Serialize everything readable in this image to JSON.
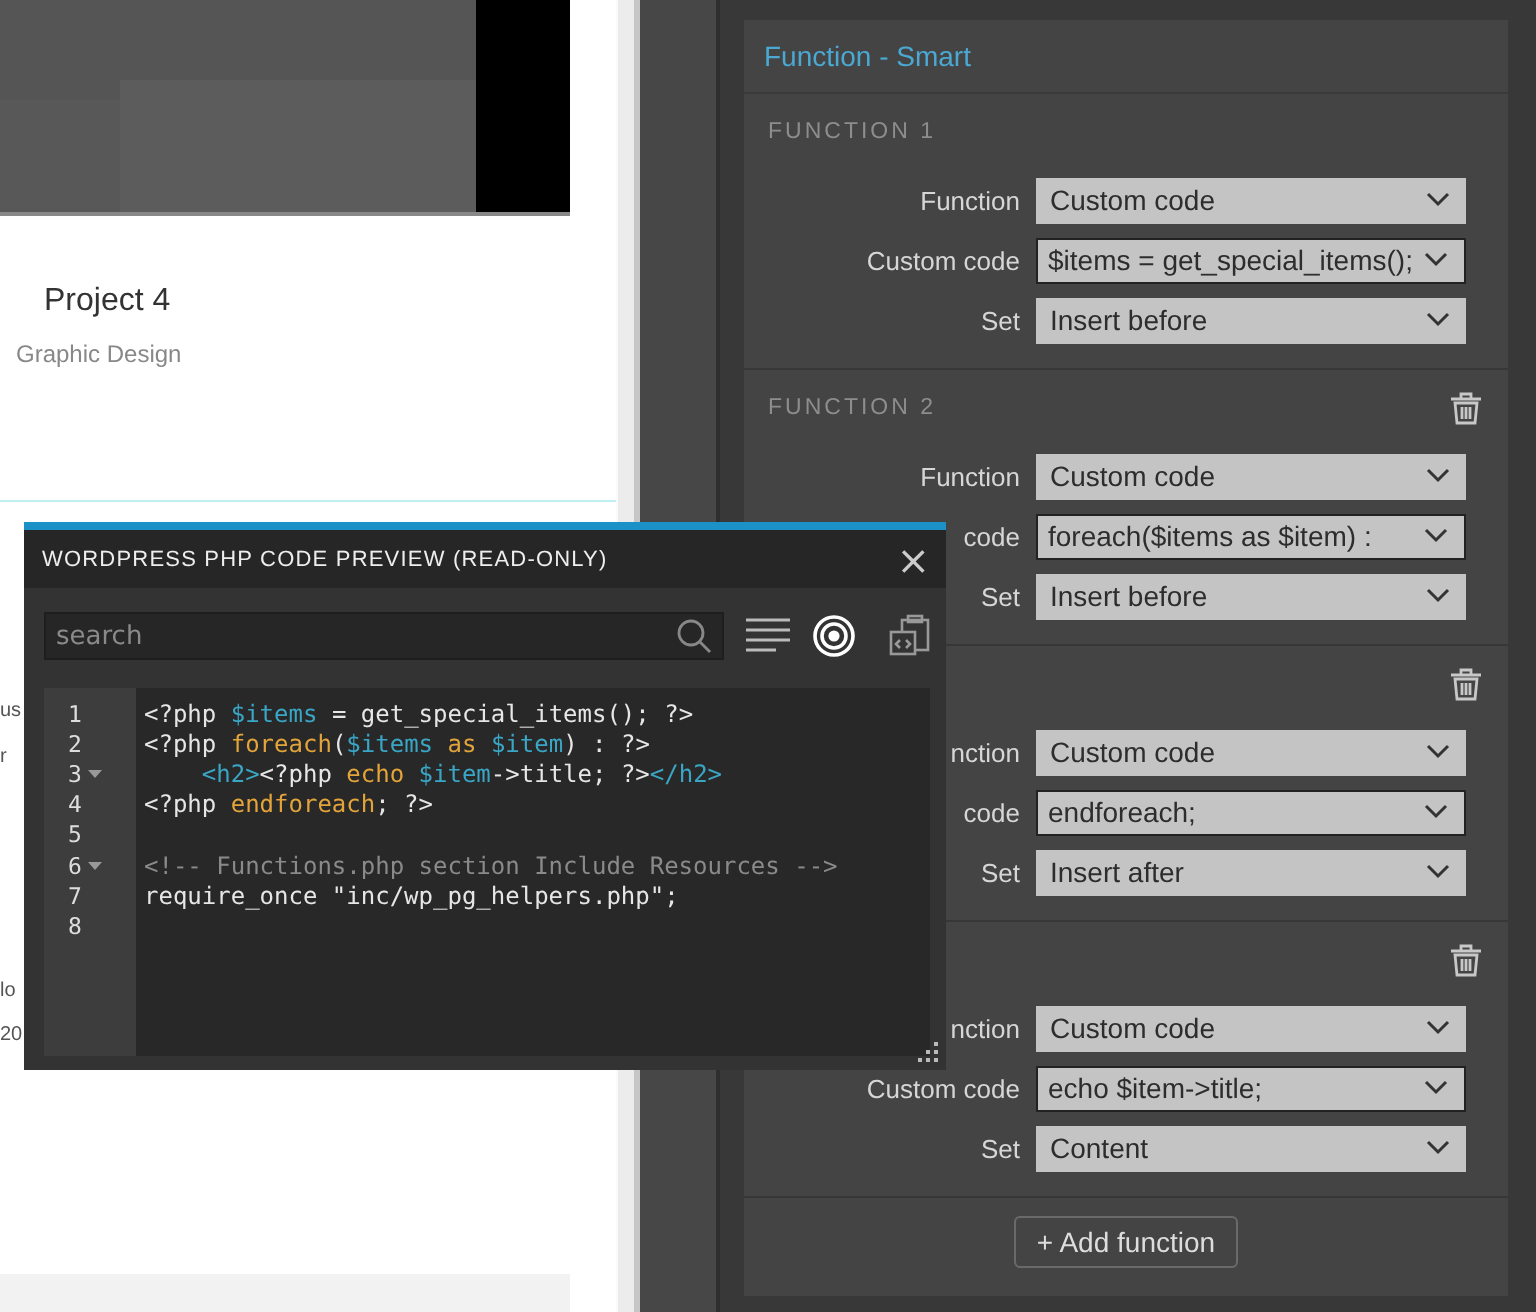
{
  "page_preview": {
    "card": {
      "kind": "picture",
      "title": "Project 4",
      "subtitle": "Graphic Design"
    },
    "hidden_fragments": [
      {
        "text": "us"
      },
      {
        "text": "r"
      },
      {
        "text": "lo"
      },
      {
        "text": "20"
      }
    ]
  },
  "panel": {
    "title": "Function - Smart",
    "functions": [
      {
        "heading": "FUNCTION 1",
        "deletable": false,
        "rows": [
          {
            "label": "Function",
            "value": "Custom code",
            "kind": "select"
          },
          {
            "label": "Custom code",
            "value": "$items = get_special_items();",
            "kind": "input"
          },
          {
            "label": "Set",
            "value": "Insert before",
            "kind": "select"
          }
        ]
      },
      {
        "heading": "FUNCTION 2",
        "deletable": true,
        "rows": [
          {
            "label": "Function",
            "value": "Custom code",
            "kind": "select"
          },
          {
            "label": "code",
            "value": "foreach($items as $item) :",
            "kind": "input"
          },
          {
            "label": "Set",
            "value": "Insert before",
            "kind": "select"
          }
        ]
      },
      {
        "deletable": true,
        "rows": [
          {
            "label": "nction",
            "value": "Custom code",
            "kind": "select"
          },
          {
            "label": "code",
            "value": "endforeach;",
            "kind": "input"
          },
          {
            "label": "Set",
            "value": "Insert after",
            "kind": "select"
          }
        ]
      },
      {
        "deletable": true,
        "rows": [
          {
            "label": "nction",
            "value": "Custom code",
            "kind": "select"
          },
          {
            "label": "Custom code",
            "value": "echo $item->title;",
            "kind": "input"
          },
          {
            "label": "Set",
            "value": "Content",
            "kind": "select"
          }
        ]
      }
    ],
    "add_button": "+ Add function"
  },
  "dialog": {
    "title": "WORDPRESS PHP CODE PREVIEW (READ-ONLY)",
    "close": "×",
    "search": {
      "placeholder": "search"
    },
    "lines": [
      {
        "number": "1",
        "fold": false,
        "tokens": [
          {
            "t": "<?php ",
            "kind": "plain"
          },
          {
            "t": "$items",
            "kind": "var"
          },
          {
            "t": " = get_special_items(); ?>",
            "kind": "plain"
          }
        ]
      },
      {
        "number": "2",
        "fold": false,
        "tokens": [
          {
            "t": "<?php ",
            "kind": "plain"
          },
          {
            "t": "foreach",
            "kind": "kw"
          },
          {
            "t": "(",
            "kind": "plain"
          },
          {
            "t": "$items",
            "kind": "var"
          },
          {
            "t": " as",
            "kind": "kw"
          },
          {
            "t": " $item",
            "kind": "var"
          },
          {
            "t": ") : ?>",
            "kind": "plain"
          }
        ]
      },
      {
        "number": "3",
        "fold": true,
        "tokens": [
          {
            "t": "    <h2>",
            "kind": "tag"
          },
          {
            "t": "<?php ",
            "kind": "plain"
          },
          {
            "t": "echo",
            "kind": "kw"
          },
          {
            "t": " $item",
            "kind": "var"
          },
          {
            "t": "->title; ?>",
            "kind": "plain"
          },
          {
            "t": "</h2>",
            "kind": "tag"
          }
        ]
      },
      {
        "number": "4",
        "fold": false,
        "tokens": [
          {
            "t": "<?php ",
            "kind": "plain"
          },
          {
            "t": "endforeach",
            "kind": "kw"
          },
          {
            "t": "; ?>",
            "kind": "plain"
          }
        ]
      },
      {
        "number": "5",
        "fold": false
      },
      {
        "number": "6",
        "fold": true,
        "tokens": [
          {
            "t": "<!-- Functions.php section Include Resources -->",
            "kind": "comment"
          }
        ]
      },
      {
        "number": "7",
        "fold": false,
        "tokens": [
          {
            "t": "require_once \"inc/wp_pg_helpers.php\";",
            "kind": "plain"
          }
        ]
      },
      {
        "number": "8",
        "fold": false
      }
    ]
  }
}
